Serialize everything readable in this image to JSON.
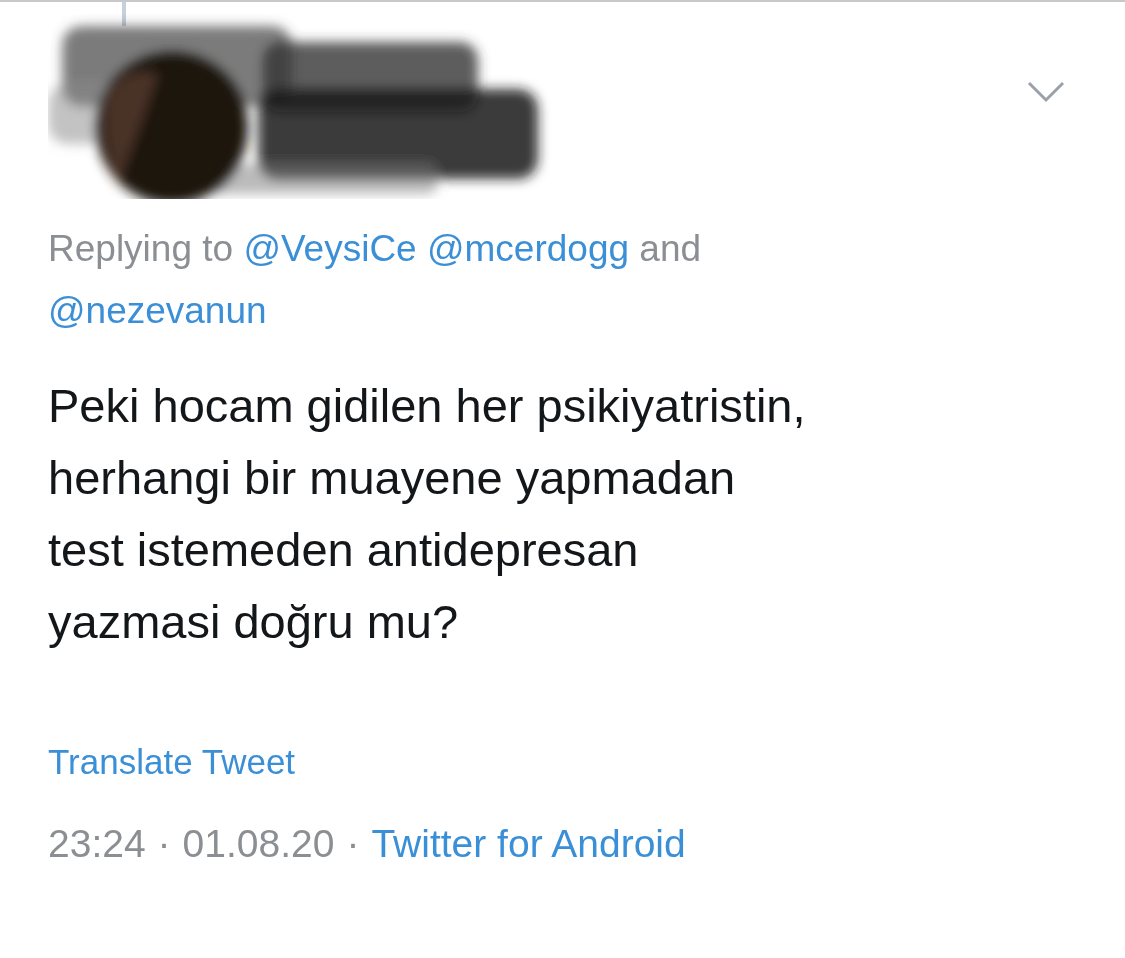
{
  "tweet": {
    "reply_prefix": "Replying to",
    "reply_handles": [
      "@VeysiCe",
      "@mcerdogg"
    ],
    "reply_joiner": "and",
    "reply_last_handle": "@nezevanun",
    "body_lines": [
      "Peki hocam gidilen her psikiyatristin,",
      "herhangi bir muayene yapmadan",
      "test istemeden antidepresan",
      "yazmasi doğru mu?"
    ],
    "translate": "Translate Tweet",
    "time": "23:24",
    "date": "01.08.20",
    "separator": "·",
    "source": "Twitter for Android"
  }
}
